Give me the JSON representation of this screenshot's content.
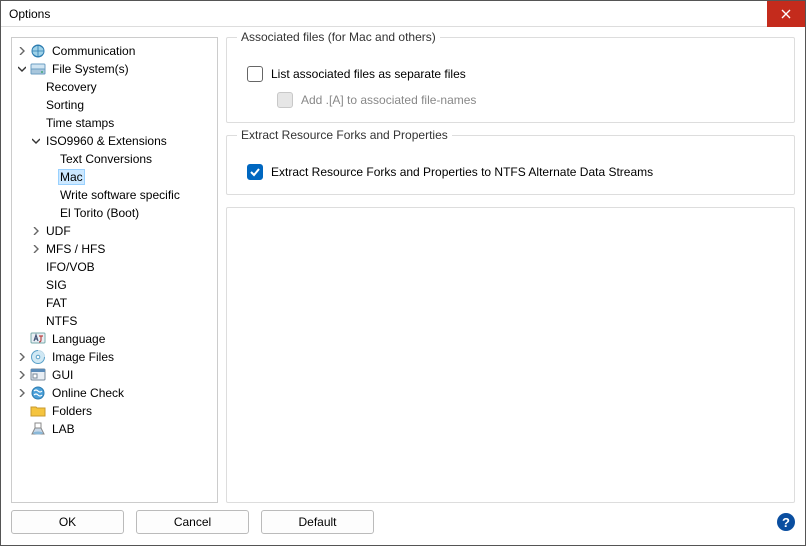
{
  "window": {
    "title": "Options"
  },
  "tree": {
    "communication": "Communication",
    "filesystems": "File System(s)",
    "recovery": "Recovery",
    "sorting": "Sorting",
    "timestamps": "Time stamps",
    "iso9960": "ISO9960 & Extensions",
    "textconv": "Text Conversions",
    "mac": "Mac",
    "writesw": "Write software specific",
    "eltorito": "El Torito (Boot)",
    "udf": "UDF",
    "mfshfs": "MFS / HFS",
    "ifovob": "IFO/VOB",
    "sig": "SIG",
    "fat": "FAT",
    "ntfs": "NTFS",
    "language": "Language",
    "imagefiles": "Image Files",
    "gui": "GUI",
    "onlinecheck": "Online Check",
    "folders": "Folders",
    "lab": "LAB"
  },
  "group1": {
    "title": "Associated files (for Mac and others)",
    "cb1": "List associated files as separate files",
    "cb2": "Add .[A] to associated file-names"
  },
  "group2": {
    "title": "Extract Resource Forks and Properties",
    "cb1": "Extract Resource Forks and Properties to NTFS Alternate Data Streams"
  },
  "buttons": {
    "ok": "OK",
    "cancel": "Cancel",
    "default": "Default"
  }
}
